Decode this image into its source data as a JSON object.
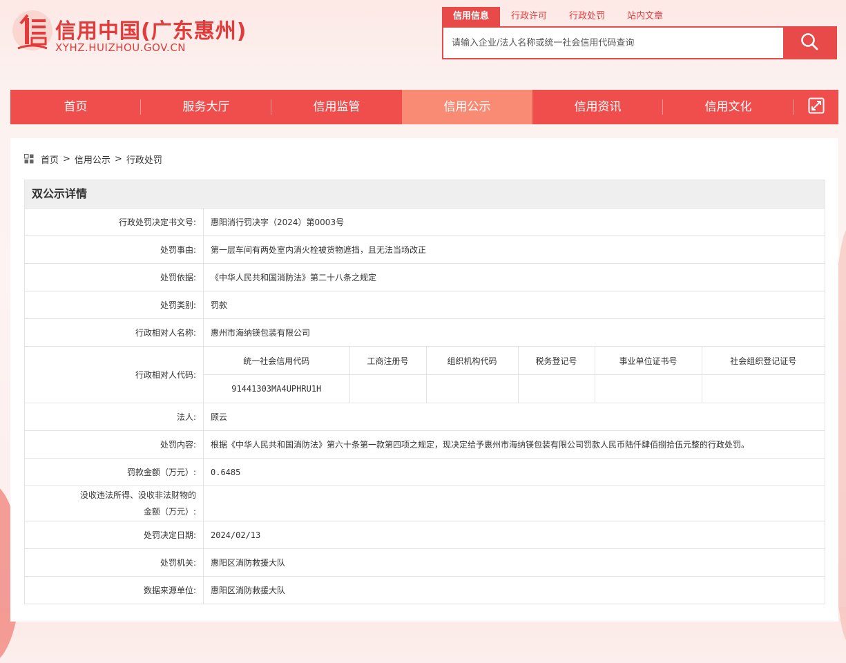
{
  "header": {
    "site_title": "信用中国(广东惠州)",
    "site_domain": "XYHZ.HUIZHOU.GOV.CN",
    "logo_icon": "xin-logo-icon",
    "brand_color": "#e84a4a"
  },
  "search": {
    "tabs": [
      "信用信息",
      "行政许可",
      "行政处罚",
      "站内文章"
    ],
    "active_tab": "信用信息",
    "placeholder": "请输入企业/法人名称或统一社会信用代码查询",
    "button_icon": "search-icon"
  },
  "nav": {
    "items": [
      "首页",
      "服务大厅",
      "信用监管",
      "信用公示",
      "信用资讯",
      "信用文化"
    ],
    "active": "信用公示",
    "expand_icon": "expand-icon"
  },
  "breadcrumb": {
    "icon": "grid-icon",
    "items": [
      "首页",
      "信用公示",
      "行政处罚"
    ],
    "separator": ">"
  },
  "detail": {
    "title": "双公示详情",
    "rows": [
      {
        "label": "行政处罚决定书文号:",
        "value": "惠阳消行罚决字（2024）第0003号"
      },
      {
        "label": "处罚事由:",
        "value": "第一层车间有两处室内消火栓被货物遮挡，且无法当场改正"
      },
      {
        "label": "处罚依据:",
        "value": "《中华人民共和国消防法》第二十八条之规定"
      },
      {
        "label": "处罚类别:",
        "value": "罚款"
      },
      {
        "label": "行政相对人名称:",
        "value": "惠州市海纳镁包装有限公司"
      }
    ],
    "code_row": {
      "label": "行政相对人代码:",
      "headers": [
        "统一社会信用代码",
        "工商注册号",
        "组织机构代码",
        "税务登记号",
        "事业单位证书号",
        "社会组织登记证号"
      ],
      "values": [
        "91441303MA4UPHRU1H",
        "",
        "",
        "",
        "",
        ""
      ]
    },
    "rows2": [
      {
        "label": "法人:",
        "value": "顾云"
      },
      {
        "label": "处罚内容:",
        "value": "根据《中华人民共和国消防法》第六十条第一款第四项之规定，现决定给予惠州市海纳镁包装有限公司罚款人民币陆仟肆佰捌拾伍元整的行政处罚。"
      },
      {
        "label": "罚款金额（万元）:",
        "value": "0.6485"
      },
      {
        "label_line1": "没收违法所得、没收非法财物的",
        "label_line2": "金额（万元）:",
        "value": ""
      },
      {
        "label": "处罚决定日期:",
        "value": "2024/02/13"
      },
      {
        "label": "处罚机关:",
        "value": "惠阳区消防救援大队"
      },
      {
        "label": "数据来源单位:",
        "value": "惠阳区消防救援大队"
      }
    ]
  }
}
